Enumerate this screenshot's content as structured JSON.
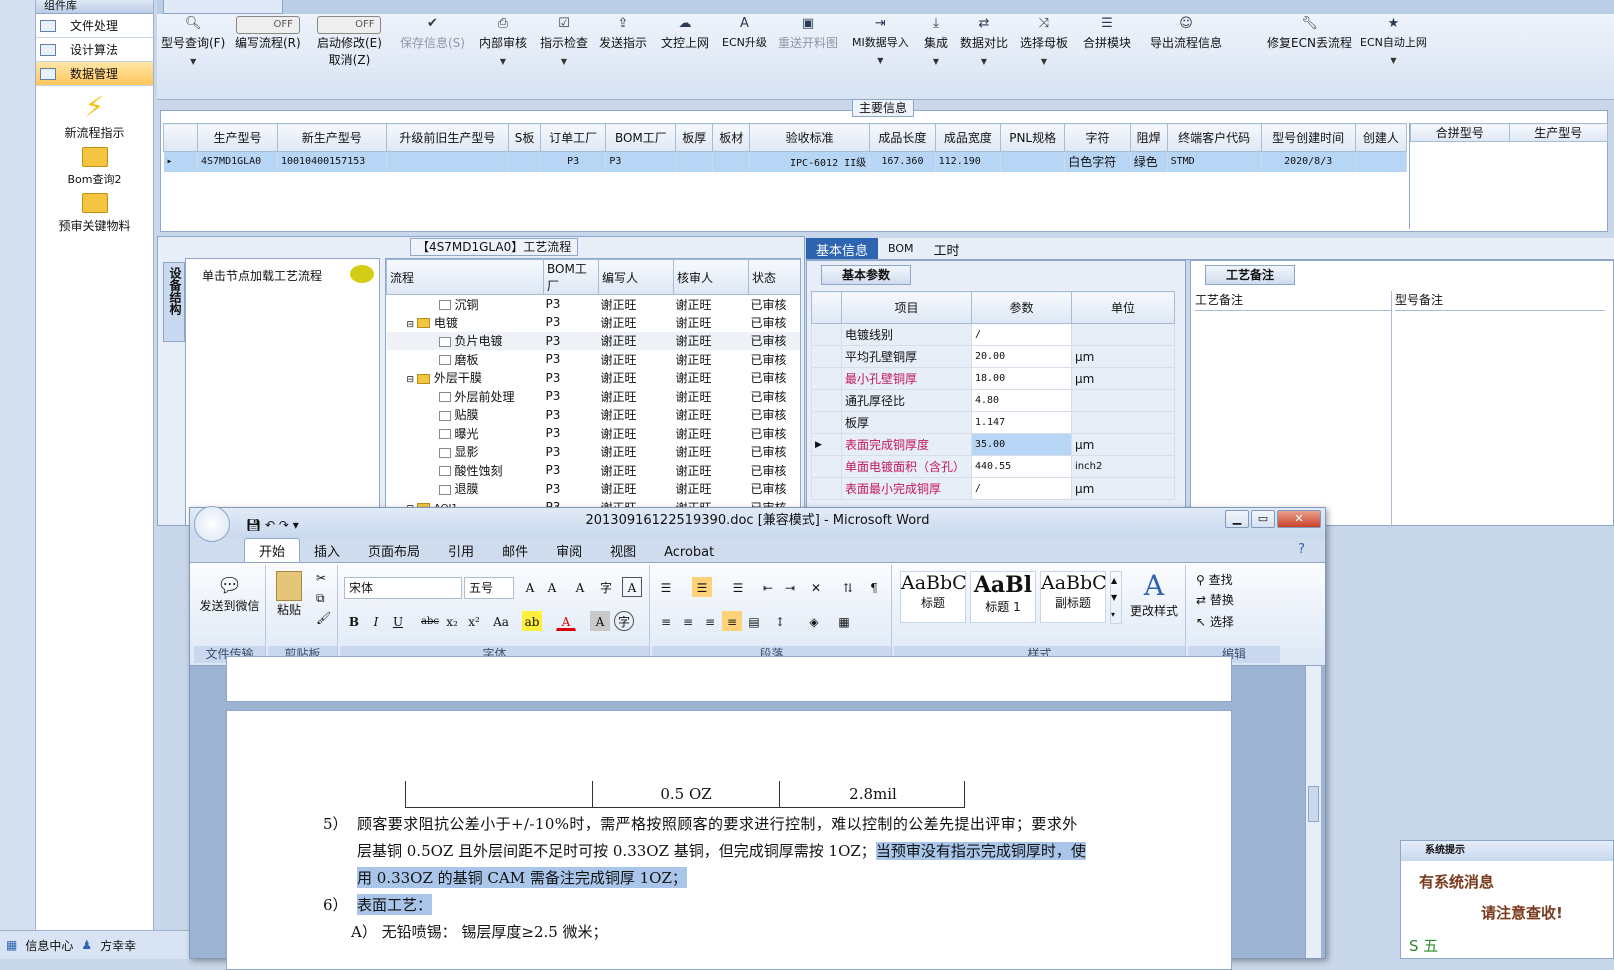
{
  "sidebar": {
    "header": "组件库",
    "items": [
      "文件处理",
      "设计算法",
      "数据管理"
    ],
    "big": [
      "新流程指示",
      "Bom查询2",
      "预审关键物料"
    ]
  },
  "status": {
    "info": "信息中心",
    "user": "方幸幸"
  },
  "toolbar": {
    "items": [
      "型号查询(F)",
      "编写流程(R)",
      "启动修改(E)",
      "取消(Z)",
      "保存信息(S)",
      "内部审核",
      "指示检查",
      "发送指示",
      "文控上网",
      "ECN升级",
      "重送开料图",
      "MI数据导入",
      "集成",
      "数据对比",
      "选择母板",
      "合拼模块",
      "导出流程信息",
      "修复ECN丢流程",
      "ECN自动上网"
    ],
    "toggle_off": "OFF"
  },
  "main": {
    "label": "主要信息",
    "headers": [
      "生产型号",
      "新生产型号",
      "升级前旧生产型号",
      "S板",
      "订单工厂",
      "BOM工厂",
      "板厚",
      "板材",
      "验收标准",
      "成品长度",
      "成品宽度",
      "PNL规格",
      "字符",
      "阻焊",
      "终端客户代码",
      "型号创建时间",
      "创建人"
    ],
    "row": [
      "4S7MD1GLA0",
      "10010400157153",
      "",
      "",
      "P3",
      "P3",
      "",
      "",
      "IPC-6012 II级",
      "167.360",
      "112.190",
      "",
      "白色字符",
      "绿色",
      "STMD",
      "2020/8/3",
      ""
    ],
    "side_headers": [
      "合拼型号",
      "生产型号"
    ]
  },
  "process": {
    "title": "【4S7MD1GLA0】工艺流程",
    "vtab": "设备结构",
    "hint": "单击节点加载工艺流程",
    "headers": [
      "流程",
      "BOM工厂",
      "编写人",
      "核审人",
      "状态"
    ],
    "rows": [
      [
        "沉铜",
        "P3",
        "谢正旺",
        "谢正旺",
        "已审核"
      ],
      [
        "电镀",
        "P3",
        "谢正旺",
        "谢正旺",
        "已审核"
      ],
      [
        "负片电镀",
        "P3",
        "谢正旺",
        "谢正旺",
        "已审核"
      ],
      [
        "磨板",
        "P3",
        "谢正旺",
        "谢正旺",
        "已审核"
      ],
      [
        "外层干膜",
        "P3",
        "谢正旺",
        "谢正旺",
        "已审核"
      ],
      [
        "外层前处理",
        "P3",
        "谢正旺",
        "谢正旺",
        "已审核"
      ],
      [
        "贴膜",
        "P3",
        "谢正旺",
        "谢正旺",
        "已审核"
      ],
      [
        "曝光",
        "P3",
        "谢正旺",
        "谢正旺",
        "已审核"
      ],
      [
        "显影",
        "P3",
        "谢正旺",
        "谢正旺",
        "已审核"
      ],
      [
        "酸性蚀刻",
        "P3",
        "谢正旺",
        "谢正旺",
        "已审核"
      ],
      [
        "退膜",
        "P3",
        "谢正旺",
        "谢正旺",
        "已审核"
      ],
      [
        "AOI1",
        "P3",
        "谢正旺",
        "谢正旺",
        "已审核"
      ]
    ]
  },
  "right": {
    "tabs": [
      "基本信息",
      "BOM",
      "工时"
    ],
    "subtab": "基本参数",
    "headers": [
      "项目",
      "参数",
      "单位"
    ],
    "rows": [
      [
        "电镀线别",
        "/",
        ""
      ],
      [
        "平均孔壁铜厚",
        "20.00",
        "μm"
      ],
      [
        "最小孔壁铜厚",
        "18.00",
        "μm"
      ],
      [
        "通孔厚径比",
        "4.80",
        ""
      ],
      [
        "板厚",
        "1.147",
        ""
      ],
      [
        "表面完成铜厚度",
        "35.00",
        "μm"
      ],
      [
        "单面电镀面积（含孔）",
        "440.55",
        "inch2"
      ],
      [
        "表面最小完成铜厚",
        "/",
        "μm"
      ]
    ],
    "notes_tab": "工艺备注",
    "notes_headers": [
      "工艺备注",
      "型号备注"
    ]
  },
  "word": {
    "title": "20130916122519390.doc [兼容模式] - Microsoft Word",
    "menu": [
      "开始",
      "插入",
      "页面布局",
      "引用",
      "邮件",
      "审阅",
      "视图",
      "Acrobat"
    ],
    "groups": [
      "文件传输",
      "剪贴板",
      "字体",
      "段落",
      "样式",
      "编辑"
    ],
    "send": "发送到微信",
    "paste": "粘贴",
    "font": "宋体",
    "size": "五号",
    "styles": [
      {
        "sample": "AaBbC",
        "name": "标题"
      },
      {
        "sample": "AaBl",
        "name": "标题 1"
      },
      {
        "sample": "AaBbC",
        "name": "副标题"
      }
    ],
    "change_style": "更改样式",
    "find": "查找",
    "replace": "替换",
    "select": "选择",
    "cells": [
      "0.5 OZ",
      "2.8mil"
    ],
    "line5a": "顾客要求阻抗公差小于+/-10%时，需严格按照顾客的要求进行控制，难以控制的公差先提出评审；要求外",
    "line5b": "层基铜 0.5OZ 且外层间距不足时可按 0.33OZ 基铜，但完成铜厚需按 1OZ；",
    "line5c": "当预审没有指示完成铜厚时，使",
    "line5d": "用 0.33OZ 的基铜 CAM 需备注完成铜厚 1OZ；",
    "num5": "5）",
    "num6": "6）",
    "line6": "表面工艺：",
    "lineA": "A） 无铅喷锡：  锡层厚度≥2.5 微米；"
  },
  "popup": {
    "title": "系统提示",
    "line1": "有系统消息",
    "line2": "请注意查收!",
    "ime": "五"
  }
}
